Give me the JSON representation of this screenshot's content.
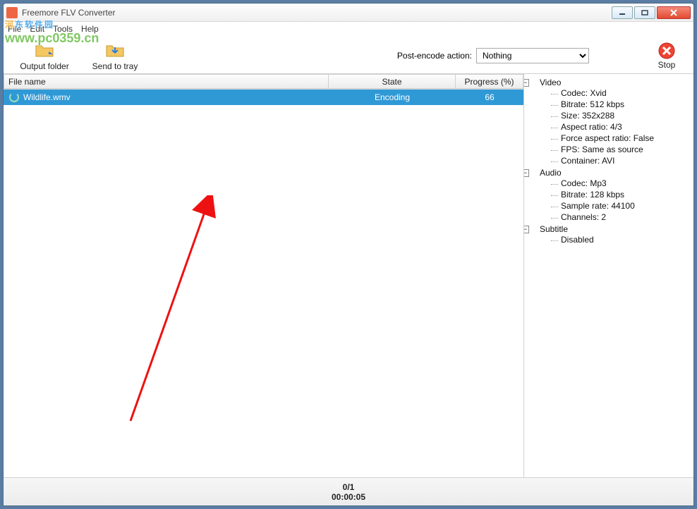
{
  "title": "Freemore FLV Converter",
  "menu": {
    "file": "File",
    "edit": "Edit",
    "tools": "Tools",
    "help": "Help"
  },
  "toolbar": {
    "output_folder": "Output folder",
    "send_to_tray": "Send to tray",
    "post_encode_label": "Post-encode action:",
    "post_encode_value": "Nothing",
    "stop": "Stop"
  },
  "columns": {
    "file": "File name",
    "state": "State",
    "progress": "Progress (%)"
  },
  "rows": [
    {
      "file": "Wildlife.wmv",
      "state": "Encoding",
      "progress": "66"
    }
  ],
  "tree": {
    "video": {
      "label": "Video",
      "codec": "Codec: Xvid",
      "bitrate": "Bitrate: 512 kbps",
      "size": "Size: 352x288",
      "aspect": "Aspect ratio: 4/3",
      "force_aspect": "Force aspect ratio: False",
      "fps": "FPS: Same as source",
      "container": "Container: AVI"
    },
    "audio": {
      "label": "Audio",
      "codec": "Codec: Mp3",
      "bitrate": "Bitrate: 128 kbps",
      "sample": "Sample rate: 44100",
      "channels": "Channels: 2"
    },
    "subtitle": {
      "label": "Subtitle",
      "disabled": "Disabled"
    }
  },
  "status": {
    "count": "0/1",
    "time": "00:00:05"
  },
  "watermark": {
    "line1a": "河",
    "line1b": "东",
    "line1c": "软件园",
    "url": "www.pc0359.cn"
  }
}
